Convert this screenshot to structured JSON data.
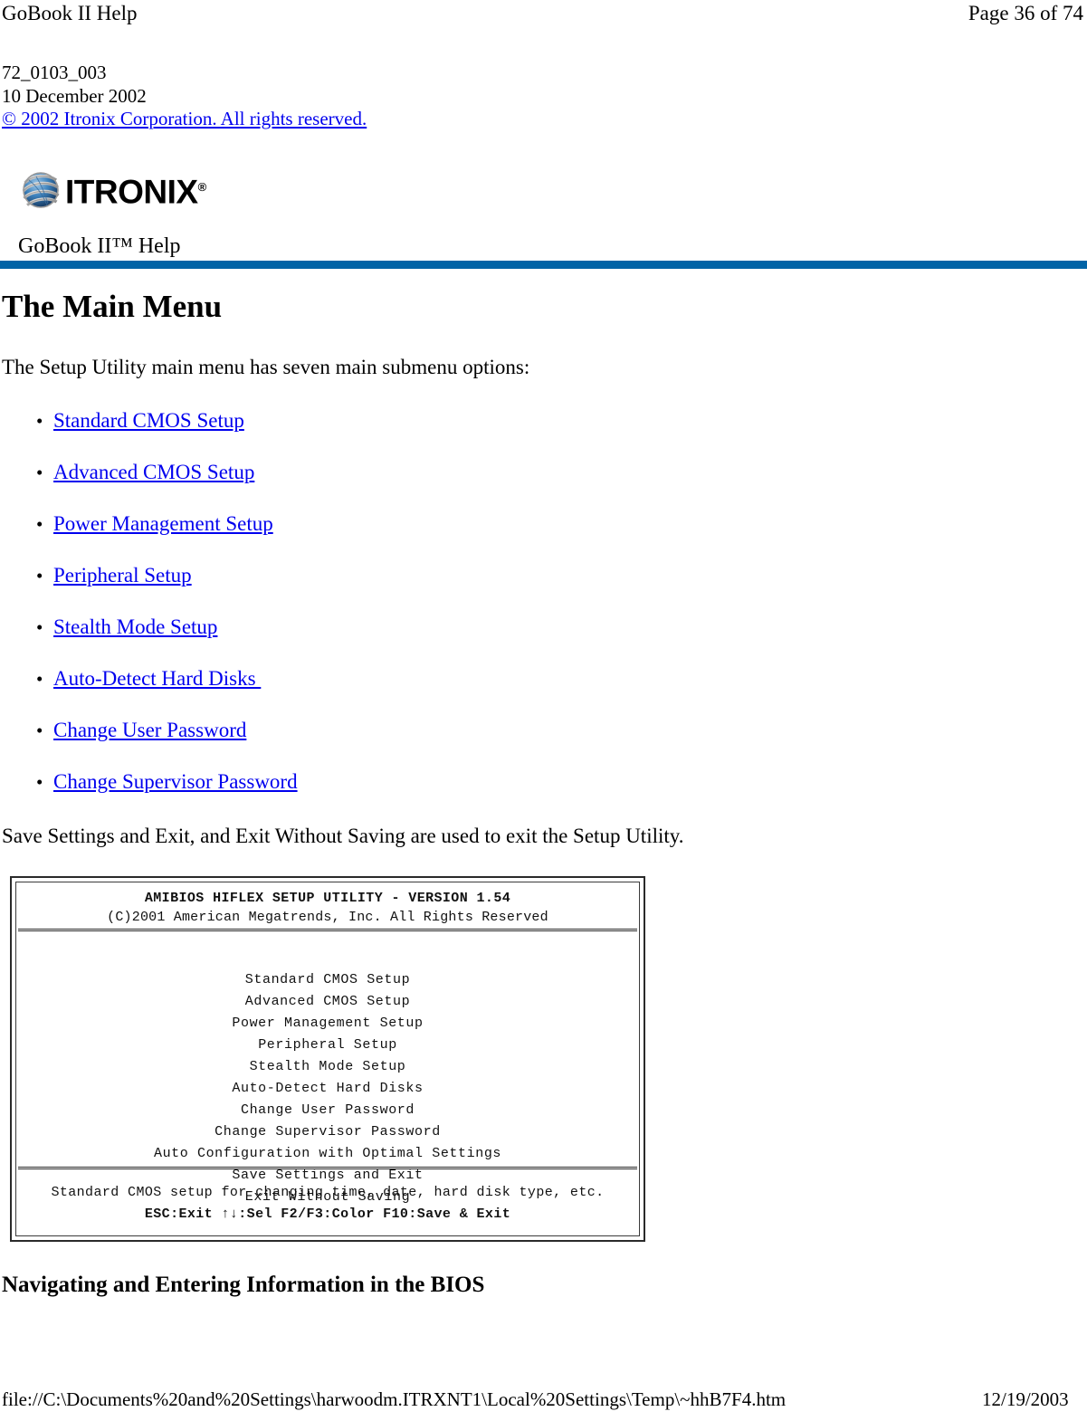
{
  "page_header": {
    "left_title": "GoBook II Help",
    "right_page_label": "Page 36 of 74"
  },
  "doc_meta": {
    "doc_number": "72_0103_003",
    "date": "10 December 2002",
    "copyright_link": "© 2002 Itronix Corporation.  All rights reserved."
  },
  "branding": {
    "wordmark": "ITRONIX",
    "registered_mark": "®",
    "product_title": "GoBook II™ Help",
    "rule_color": "#0063a6",
    "globe_blue": "#2a6fae",
    "globe_silver": "#c9c9c9",
    "link_color": "#0000ee"
  },
  "main": {
    "section_title": "The Main Menu",
    "intro_text": "The Setup Utility main menu has seven main submenu options:",
    "submenu_links": [
      "Standard CMOS Setup",
      "Advanced CMOS Setup",
      "Power Management Setup",
      "Peripheral Setup",
      "Stealth Mode Setup",
      "Auto-Detect Hard Disks ",
      "Change User Password",
      "Change Supervisor Password"
    ],
    "exit_text": "Save Settings and Exit, and Exit Without Saving are used to exit the Setup Utility.",
    "subsection_title": "Navigating and Entering Information in the BIOS"
  },
  "bios_screen": {
    "title_line_1": "AMIBIOS HIFLEX SETUP UTILITY - VERSION 1.54",
    "title_line_2": "(C)2001 American Megatrends, Inc. All Rights Reserved",
    "menu_items": [
      "Standard CMOS Setup",
      "Advanced CMOS Setup",
      "Power Management Setup",
      "Peripheral Setup",
      "Stealth Mode Setup",
      "Auto-Detect Hard Disks",
      "Change User Password",
      "Change Supervisor Password",
      "Auto Configuration with Optimal Settings",
      "Save Settings and Exit",
      "Exit Without Saving"
    ],
    "status_help": "Standard CMOS setup for changing time, date, hard disk type, etc.",
    "status_keys": "ESC:Exit ↑↓:Sel  F2/F3:Color  F10:Save & Exit"
  },
  "page_footer": {
    "file_path": "file://C:\\Documents%20and%20Settings\\harwoodm.ITRXNT1\\Local%20Settings\\Temp\\~hhB7F4.htm",
    "print_date": "12/19/2003"
  }
}
